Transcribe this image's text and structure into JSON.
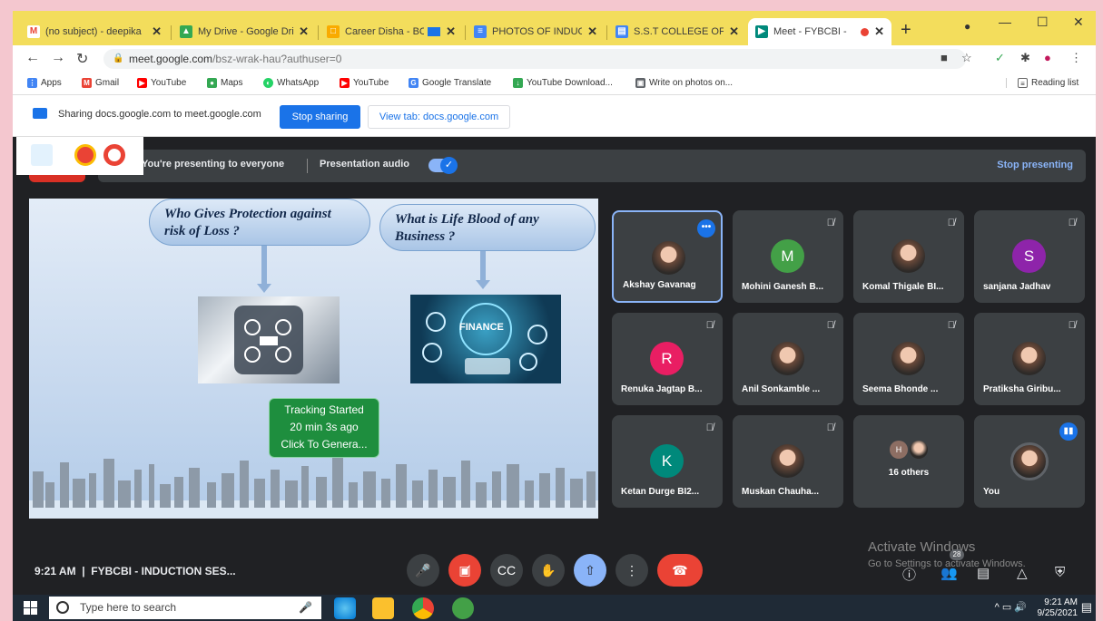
{
  "tabs": [
    {
      "label": "(no subject) - deepika",
      "icon_color": "#ea4335",
      "icon_char": "M"
    },
    {
      "label": "My Drive - Google Dri",
      "icon_color": "#fbbc04",
      "icon_char": "▲"
    },
    {
      "label": "Career Disha - BC",
      "icon_color": "#f9ab00",
      "icon_char": "□"
    },
    {
      "label": "PHOTOS OF INDUCTIO",
      "icon_color": "#4285f4",
      "icon_char": "≡"
    },
    {
      "label": "S.S.T COLLEGE OF AR",
      "icon_color": "#4285f4",
      "icon_char": "▤"
    },
    {
      "label": "Meet - FYBCBI -",
      "icon_color": "#00897b",
      "icon_char": "▶"
    }
  ],
  "address": {
    "host": "meet.google.com",
    "path": "/bsz-wrak-hau?authuser=0"
  },
  "bookmarks": [
    {
      "label": "Apps",
      "color": "#4285f4"
    },
    {
      "label": "Gmail",
      "color": "#ea4335"
    },
    {
      "label": "YouTube",
      "color": "#ff0000"
    },
    {
      "label": "Maps",
      "color": "#34a853"
    },
    {
      "label": "WhatsApp",
      "color": "#25d366"
    },
    {
      "label": "YouTube",
      "color": "#ff0000"
    },
    {
      "label": "Google Translate",
      "color": "#4285f4"
    },
    {
      "label": "YouTube Download...",
      "color": "#34a853"
    },
    {
      "label": "Write on photos on...",
      "color": "#5f6368"
    }
  ],
  "reading_list": "Reading list",
  "sharing": {
    "text": "Sharing docs.google.com to meet.google.com",
    "stop_label": "Stop sharing",
    "view_label": "View tab: docs.google.com"
  },
  "presenting": {
    "text": "You're presenting to everyone",
    "audio_label": "Presentation audio",
    "stop_label": "Stop presenting"
  },
  "slide": {
    "question1": "Who Gives Protection against risk of Loss ?",
    "question2": "What is Life Blood of any Business ?",
    "pic2_caption": "FINANCE"
  },
  "participants": [
    {
      "name": "Akshay Gavanag",
      "initial": "",
      "color": "",
      "photo": true,
      "selected": true
    },
    {
      "name": "Mohini Ganesh B...",
      "initial": "M",
      "color": "#43a047",
      "photo": false
    },
    {
      "name": "Komal Thigale BI...",
      "initial": "",
      "color": "",
      "photo": true
    },
    {
      "name": "sanjana Jadhav",
      "initial": "S",
      "color": "#8e24aa",
      "photo": false
    },
    {
      "name": "Renuka Jagtap B...",
      "initial": "R",
      "color": "#e91e63",
      "photo": false
    },
    {
      "name": "Anil Sonkamble ...",
      "initial": "",
      "color": "",
      "photo": true
    },
    {
      "name": "Seema Bhonde ...",
      "initial": "",
      "color": "",
      "photo": true
    },
    {
      "name": "Pratiksha Giribu...",
      "initial": "",
      "color": "",
      "photo": true
    },
    {
      "name": "Ketan Durge BI2...",
      "initial": "K",
      "color": "#00897b",
      "photo": false
    },
    {
      "name": "Muskan Chauha...",
      "initial": "",
      "color": "",
      "photo": true
    },
    {
      "name": "16 others",
      "initial": "H",
      "color": "#8d6e63",
      "photo": false
    },
    {
      "name": "You",
      "initial": "",
      "color": "",
      "photo": true
    }
  ],
  "meeting": {
    "time": "9:21 AM",
    "title": "FYBCBI - INDUCTION SES..."
  },
  "tracking": {
    "line1": "Tracking Started",
    "line2": "20 min 3s ago",
    "line3": "Click To Genera..."
  },
  "participants_count": "28",
  "watermark": {
    "line1": "Activate Windows",
    "line2": "Go to Settings to activate Windows."
  },
  "taskbar": {
    "search_placeholder": "Type here to search",
    "time": "9:21 AM",
    "date": "9/25/2021"
  }
}
